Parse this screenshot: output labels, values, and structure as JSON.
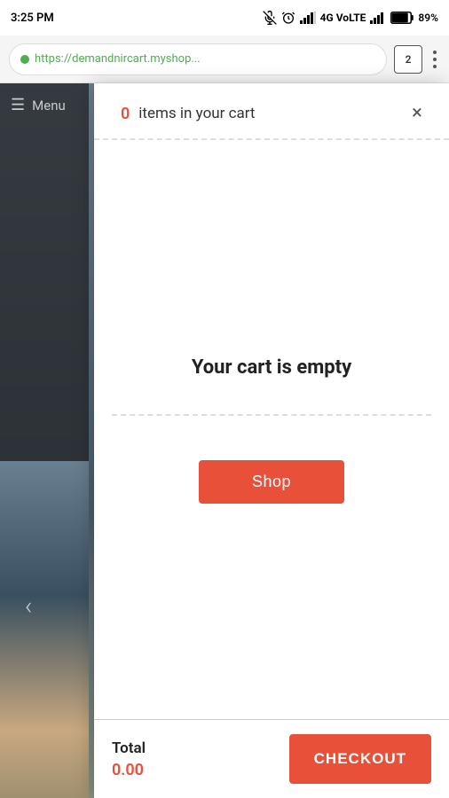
{
  "statusBar": {
    "time": "3:25 PM",
    "network": "4G VoLTE",
    "battery": "89%"
  },
  "browserBar": {
    "url": "https://demandnircart.myshop...",
    "tabCount": "2"
  },
  "background": {
    "menuLabel": "Menu",
    "arrowLabel": "‹"
  },
  "cart": {
    "header": {
      "countLabel": "0",
      "titleText": "items in your cart",
      "closeLabel": "×"
    },
    "body": {
      "emptyText": "Your cart is empty",
      "shopButtonLabel": "Shop"
    },
    "footer": {
      "totalLabel": "Total",
      "totalAmount": "0.00",
      "checkoutButtonLabel": "CHECKOUT"
    }
  }
}
